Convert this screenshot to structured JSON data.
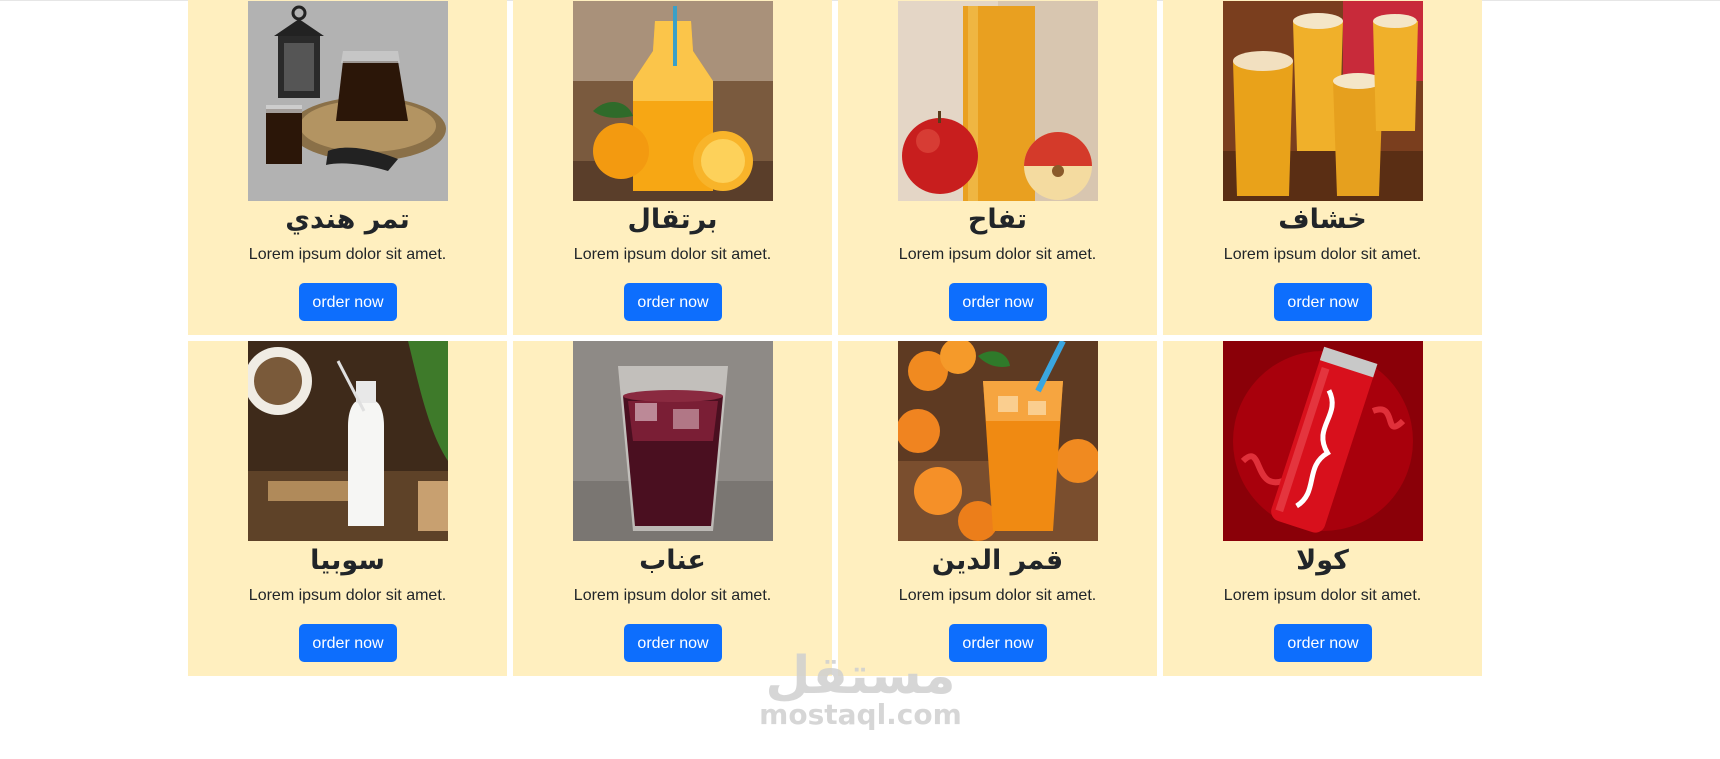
{
  "products": [
    {
      "name": "تمر هندي",
      "description": "Lorem ipsum dolor sit amet.",
      "button": "order now",
      "image": "tamarind-drink-photo"
    },
    {
      "name": "برتقال",
      "description": "Lorem ipsum dolor sit amet.",
      "button": "order now",
      "image": "orange-juice-photo"
    },
    {
      "name": "تفاح",
      "description": "Lorem ipsum dolor sit amet.",
      "button": "order now",
      "image": "apple-juice-photo"
    },
    {
      "name": "خشاف",
      "description": "Lorem ipsum dolor sit amet.",
      "button": "order now",
      "image": "khoshaf-photo"
    },
    {
      "name": "سوبيا",
      "description": "Lorem ipsum dolor sit amet.",
      "button": "order now",
      "image": "sobia-photo"
    },
    {
      "name": "عناب",
      "description": "Lorem ipsum dolor sit amet.",
      "button": "order now",
      "image": "jujube-drink-photo"
    },
    {
      "name": "قمر الدين",
      "description": "Lorem ipsum dolor sit amet.",
      "button": "order now",
      "image": "apricot-drink-photo"
    },
    {
      "name": "كولا",
      "description": "Lorem ipsum dolor sit amet.",
      "button": "order now",
      "image": "cola-can-photo"
    }
  ],
  "watermark": {
    "logo": "مستقل",
    "text": "mostaql.com"
  },
  "colors": {
    "card_background": "#ffefbf",
    "button": "#0d6efd",
    "button_text": "#ffffff",
    "title_text": "#212529"
  }
}
